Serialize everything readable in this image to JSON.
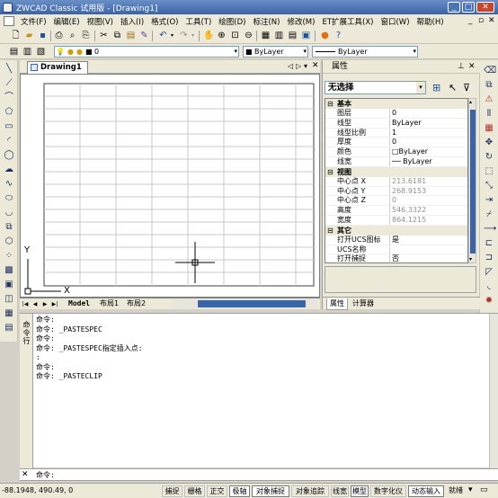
{
  "window": {
    "title": "ZWCAD Classic 试用版 - [Drawing1]"
  },
  "menu": [
    "文件(F)",
    "编辑(E)",
    "视图(V)",
    "插入(I)",
    "格式(O)",
    "工具(T)",
    "绘图(D)",
    "标注(N)",
    "修改(M)",
    "ET扩展工具(X)",
    "窗口(W)",
    "帮助(H)"
  ],
  "layer_toolbar": {
    "layer": "0",
    "color": "ByLayer",
    "linetype": "ByLayer"
  },
  "drawing": {
    "tab": "Drawing1",
    "axis_x": "X",
    "axis_y": "Y"
  },
  "layout_tabs": [
    "Model",
    "布局1",
    "布局2"
  ],
  "properties": {
    "header": "属性",
    "selection": "无选择",
    "sections": [
      {
        "title": "基本",
        "rows": [
          {
            "key": "图层",
            "value": "0",
            "gray": false
          },
          {
            "key": "线型",
            "value": "ByLayer",
            "gray": false
          },
          {
            "key": "线型比例",
            "value": "1",
            "gray": false
          },
          {
            "key": "厚度",
            "value": "0",
            "gray": false
          },
          {
            "key": "颜色",
            "value": "□ByLayer",
            "gray": false
          },
          {
            "key": "线宽",
            "value": "── ByLayer",
            "gray": false
          }
        ]
      },
      {
        "title": "视图",
        "rows": [
          {
            "key": "中心点 X",
            "value": "213.6181",
            "gray": true
          },
          {
            "key": "中心点 Y",
            "value": "268.9153",
            "gray": true
          },
          {
            "key": "中心点 Z",
            "value": "0",
            "gray": true
          },
          {
            "key": "高度",
            "value": "546.3322",
            "gray": true
          },
          {
            "key": "宽度",
            "value": "864.1215",
            "gray": true
          }
        ]
      },
      {
        "title": "其它",
        "rows": [
          {
            "key": "打开UCS图标",
            "value": "是",
            "gray": false
          },
          {
            "key": "UCS名称",
            "value": "",
            "gray": false
          },
          {
            "key": "打开捕捉",
            "value": "否",
            "gray": false
          }
        ]
      }
    ],
    "tabs": [
      "属性",
      "计算器"
    ]
  },
  "command": {
    "side_label": "命令行",
    "history": [
      "命令:",
      "命令: _PASTESPEC",
      "命令:",
      "命令: _PASTESPEC指定插入点:",
      ":",
      "命令:",
      "命令: _PASTECLIP"
    ],
    "prompt": "命令:"
  },
  "status": {
    "coords": "-88.1948, 490.49, 0",
    "buttons": [
      {
        "label": "捕捉",
        "on": false
      },
      {
        "label": "栅格",
        "on": false
      },
      {
        "label": "正交",
        "on": false
      },
      {
        "label": "极轴",
        "on": true
      },
      {
        "label": "对象捕捉",
        "on": true
      },
      {
        "label": "对象追踪",
        "on": false
      },
      {
        "label": "线宽",
        "on": false
      },
      {
        "label": "模型",
        "on": true
      },
      {
        "label": "数字化仪",
        "on": false
      },
      {
        "label": "动态输入",
        "on": true
      },
      {
        "label": "就绪",
        "on": false
      }
    ]
  }
}
